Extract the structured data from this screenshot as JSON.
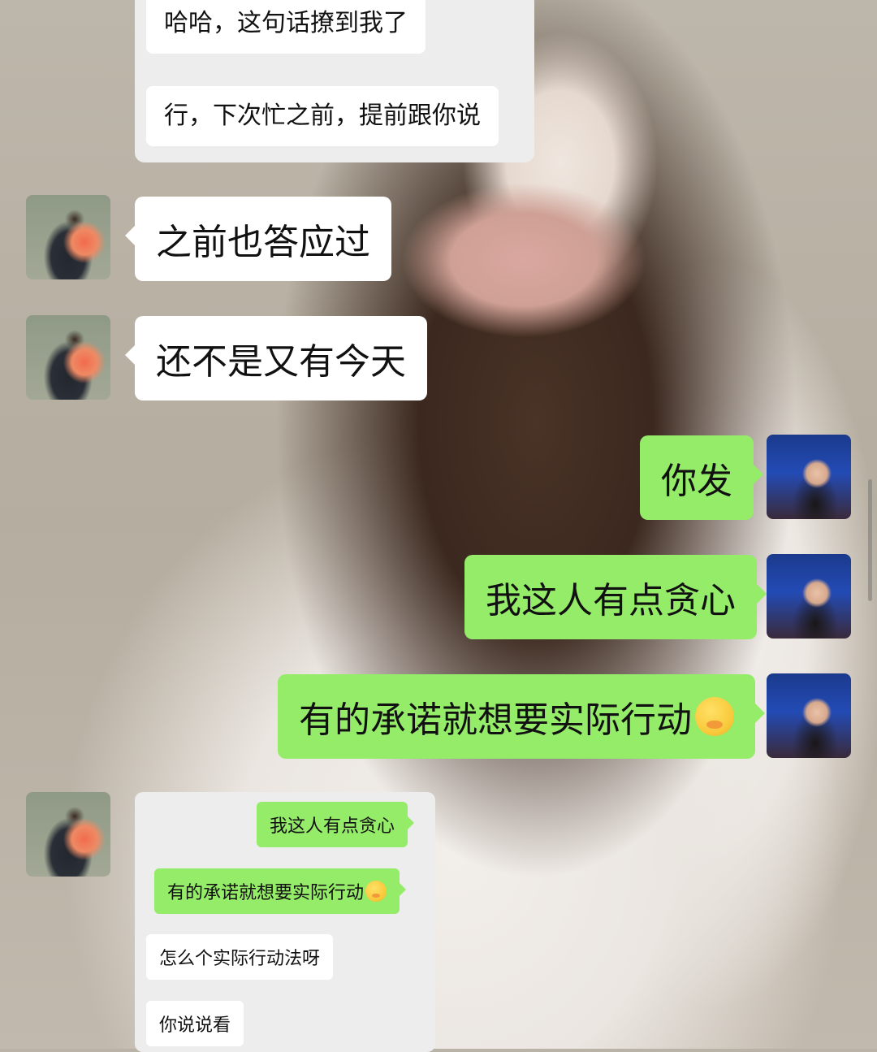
{
  "forwarded_top": [
    {
      "text": "哈哈，这句话撩到我了"
    },
    {
      "text": "行，下次忙之前，提前跟你说"
    }
  ],
  "messages": [
    {
      "side": "left",
      "avatar": "avatar-girl-with-flowers",
      "text": "之前也答应过"
    },
    {
      "side": "left",
      "avatar": "avatar-girl-with-flowers",
      "text": "还不是又有今天"
    },
    {
      "side": "right",
      "avatar": "avatar-girl-night-city",
      "text": "你发"
    },
    {
      "side": "right",
      "avatar": "avatar-girl-night-city",
      "text": "我这人有点贪心"
    },
    {
      "side": "right",
      "avatar": "avatar-girl-night-city",
      "text": "有的承诺就想要实际行动",
      "emoji": "hand-over-mouth-emoji"
    }
  ],
  "quote_card": {
    "items": [
      {
        "type": "sent",
        "text": "我这人有点贪心"
      },
      {
        "type": "sent",
        "text": "有的承诺就想要实际行动",
        "emoji": "hand-over-mouth-emoji"
      },
      {
        "type": "received",
        "text": "怎么个实际行动法呀"
      },
      {
        "type": "received",
        "text": "你说说看"
      }
    ]
  },
  "colors": {
    "sent_bubble": "#95ec69",
    "received_bubble": "#ffffff",
    "panel": "#ededed"
  }
}
